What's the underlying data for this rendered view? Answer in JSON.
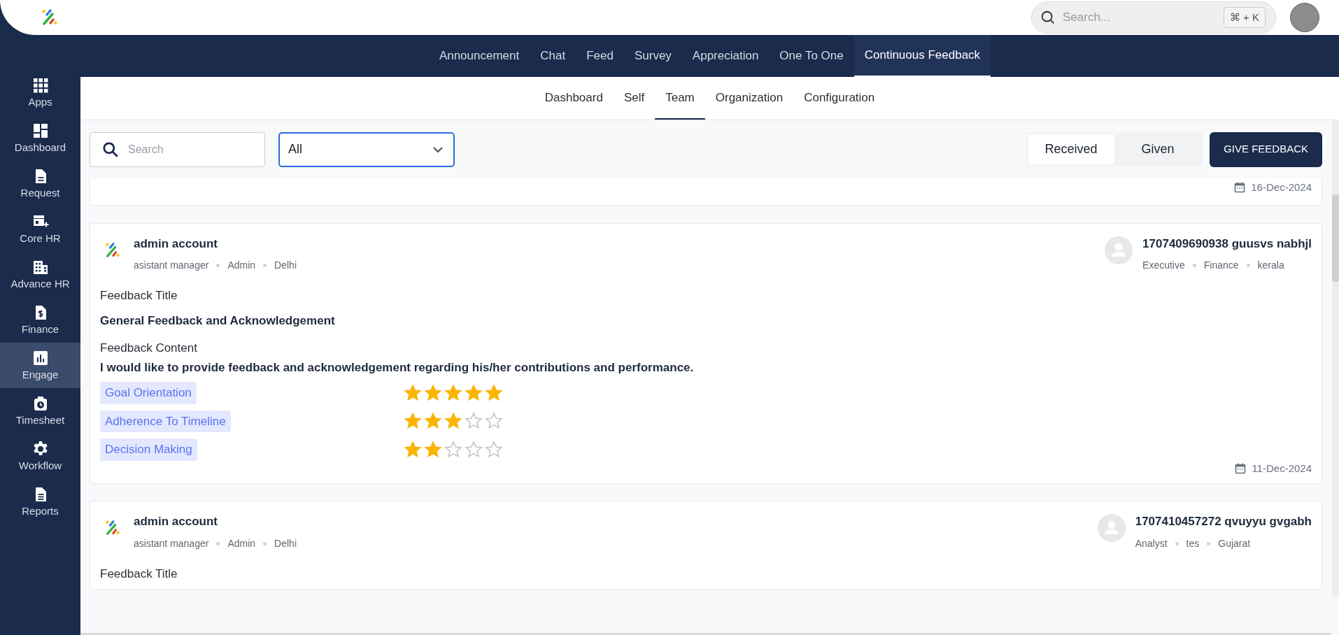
{
  "header": {
    "search": {
      "placeholder": "Search...",
      "shortcut": "⌘ + K"
    }
  },
  "sidebar": {
    "items": [
      {
        "label": "Apps",
        "kind": "apps",
        "selected": false
      },
      {
        "label": "Dashboard",
        "kind": "dashboard",
        "selected": false
      },
      {
        "label": "Request",
        "kind": "request",
        "selected": false
      },
      {
        "label": "Core HR",
        "kind": "corehr",
        "selected": false
      },
      {
        "label": "Advance HR",
        "kind": "advancehr",
        "selected": false
      },
      {
        "label": "Finance",
        "kind": "finance",
        "selected": false
      },
      {
        "label": "Engage",
        "kind": "engage",
        "selected": true
      },
      {
        "label": "Timesheet",
        "kind": "timesheet",
        "selected": false
      },
      {
        "label": "Workflow",
        "kind": "workflow",
        "selected": false
      },
      {
        "label": "Reports",
        "kind": "reports",
        "selected": false
      }
    ]
  },
  "top_tabs": [
    {
      "label": "Announcement",
      "selected": false
    },
    {
      "label": "Chat",
      "selected": false
    },
    {
      "label": "Feed",
      "selected": false
    },
    {
      "label": "Survey",
      "selected": false
    },
    {
      "label": "Appreciation",
      "selected": false
    },
    {
      "label": "One To One",
      "selected": false
    },
    {
      "label": "Continuous Feedback",
      "selected": true
    }
  ],
  "sub_tabs": [
    {
      "label": "Dashboard",
      "selected": false
    },
    {
      "label": "Self",
      "selected": false
    },
    {
      "label": "Team",
      "selected": true
    },
    {
      "label": "Organization",
      "selected": false
    },
    {
      "label": "Configuration",
      "selected": false
    }
  ],
  "toolbar": {
    "search": {
      "placeholder": "Search"
    },
    "filter": {
      "value": "All"
    },
    "toggle": [
      {
        "label": "Received",
        "selected": true
      },
      {
        "label": "Given",
        "selected": false
      }
    ],
    "button": "GIVE FEEDBACK"
  },
  "cards": [
    {
      "date": "16-Dec-2024"
    },
    {
      "from": {
        "name": "admin account",
        "meta": [
          "asistant manager",
          "Admin",
          "Delhi"
        ]
      },
      "to": {
        "name": "1707409690938 guusvs nabhjl",
        "meta": [
          "Executive",
          "Finance",
          "kerala"
        ]
      },
      "title_label": "Feedback Title",
      "title": "General Feedback and Acknowledgement",
      "content_label": "Feedback Content",
      "content": "I would like to provide feedback and acknowledgement regarding his/her contributions and performance.",
      "ratings": [
        {
          "label": "Goal Orientation",
          "stars": 5
        },
        {
          "label": "Adherence To Timeline",
          "stars": 3
        },
        {
          "label": "Decision Making",
          "stars": 2
        }
      ],
      "date": "11-Dec-2024"
    },
    {
      "from": {
        "name": "admin account",
        "meta": [
          "asistant manager",
          "Admin",
          "Delhi"
        ]
      },
      "to": {
        "name": "1707410457272 qvuyyu gvgabh",
        "meta": [
          "Analyst",
          "tes",
          "Gujarat"
        ]
      },
      "title_label": "Feedback Title"
    }
  ]
}
